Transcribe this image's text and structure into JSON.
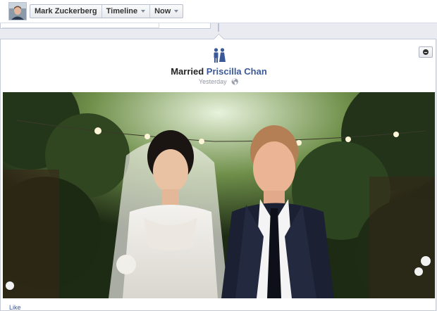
{
  "header": {
    "user_name": "Mark Zuckerberg",
    "timeline_label": "Timeline",
    "now_label": "Now"
  },
  "story": {
    "event_icon": "wedding-couple-icon",
    "verb": "Married",
    "partner": "Priscilla Chan",
    "time": "Yesterday",
    "privacy_icon": "globe-icon",
    "like_label": "Like",
    "collapse_icon": "minus-circle-icon"
  },
  "colors": {
    "link": "#3b5998",
    "icon_blue": "#3b5998"
  }
}
